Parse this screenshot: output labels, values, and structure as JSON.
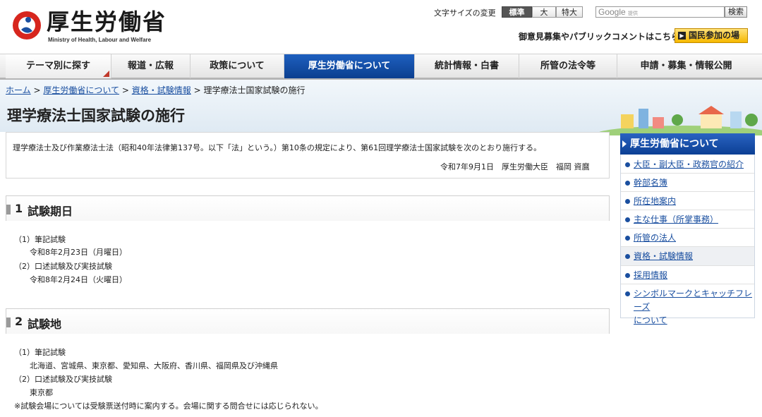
{
  "header": {
    "logo_title": "厚生労働省",
    "logo_subtitle": "Ministry of Health, Labour and Welfare",
    "font_size_label": "文字サイズの変更",
    "font_size_options": [
      "標準",
      "大",
      "特大"
    ],
    "search_placeholder_brand": "Google",
    "search_placeholder_small": "提供",
    "search_button": "検索",
    "public_comment_link": "御意見募集やパブリックコメントはこちら",
    "kokumin_button": "国民参加の場"
  },
  "nav": {
    "items": [
      {
        "label": "テーマ別に探す"
      },
      {
        "label": "報道・広報"
      },
      {
        "label": "政策について"
      },
      {
        "label": "厚生労働省について"
      },
      {
        "label": "統計情報・白書"
      },
      {
        "label": "所管の法令等"
      },
      {
        "label": "申請・募集・情報公開"
      }
    ]
  },
  "breadcrumb": {
    "links": [
      "ホーム",
      "厚生労働省について",
      "資格・試験情報"
    ],
    "separator": ">",
    "current": "理学療法士国家試験の施行"
  },
  "page_title": "理学療法士国家試験の施行",
  "intro": {
    "text": "理学療法士及び作業療法士法（昭和40年法律第137号。以下「法」という。）第10条の規定により、第61回理学療法士国家試験を次のとおり施行する。",
    "signature": "令和7年9月1日　厚生労働大臣　福岡 資麿"
  },
  "sections": [
    {
      "number": "1",
      "title": "試験期日",
      "lines": [
        "（1）筆記試験",
        "令和8年2月23日（月曜日）",
        "（2）口述試験及び実技試験",
        "令和8年2月24日（火曜日）"
      ]
    },
    {
      "number": "2",
      "title": "試験地",
      "lines": [
        "（1）筆記試験",
        "北海道、宮城県、東京都、愛知県、大阪府、香川県、福岡県及び沖縄県",
        "（2）口述試験及び実技試験",
        "東京都",
        "※試験会場については受験票送付時に案内する。会場に関する問合せには応じられない。"
      ]
    }
  ],
  "sidebar": {
    "heading": "厚生労働省について",
    "items": [
      {
        "label": "大臣・副大臣・政務官の紹介"
      },
      {
        "label": "幹部名簿"
      },
      {
        "label": "所在地案内"
      },
      {
        "label": "主な仕事（所掌事務）"
      },
      {
        "label": "所管の法人"
      },
      {
        "label": "資格・試験情報"
      },
      {
        "label": "採用情報"
      },
      {
        "label": "シンボルマークとキャッチフレーズ",
        "label_line2": "について"
      }
    ]
  },
  "colors": {
    "nav_active": "#1454b0",
    "link": "#1a4fa0",
    "kokumin_button": "#f6b800"
  }
}
